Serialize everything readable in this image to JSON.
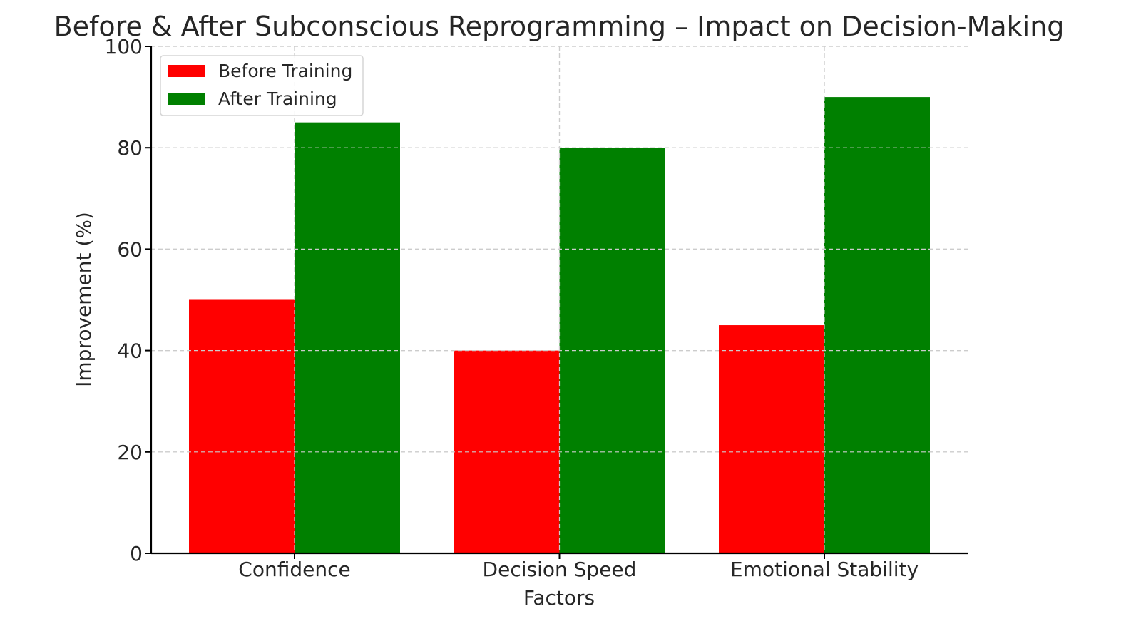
{
  "chart_data": {
    "type": "bar",
    "title": "Before & After Subconscious Reprogramming – Impact on Decision-Making",
    "xlabel": "Factors",
    "ylabel": "Improvement (%)",
    "categories": [
      "Confidence",
      "Decision Speed",
      "Emotional Stability"
    ],
    "series": [
      {
        "name": "Before Training",
        "color": "#ff0000",
        "values": [
          50,
          40,
          45
        ]
      },
      {
        "name": "After Training",
        "color": "#008000",
        "values": [
          85,
          80,
          90
        ]
      }
    ],
    "ylim": [
      0,
      100
    ],
    "yticks": [
      0,
      20,
      40,
      60,
      80,
      100
    ],
    "grid": true,
    "legend_position": "top-left"
  }
}
